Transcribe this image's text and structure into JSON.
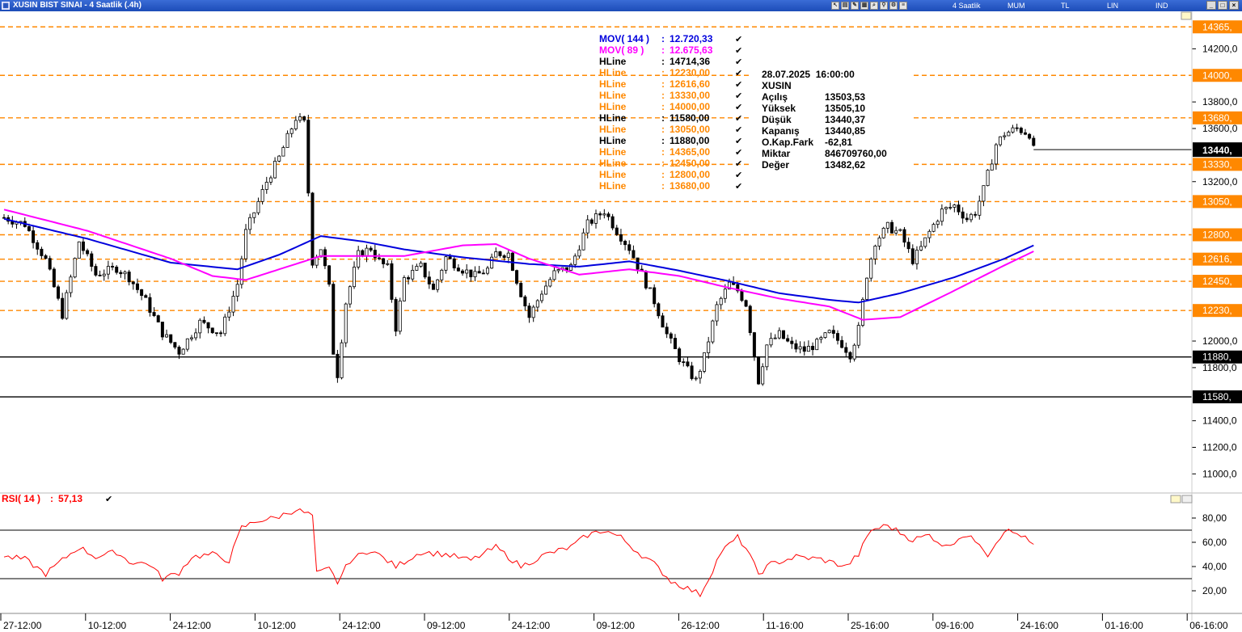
{
  "window": {
    "title": "XUSIN BIST SINAI - 4 Saatlik (.4h)",
    "period": "4 Saatlik",
    "style": "MUM",
    "currency": "TL",
    "scale": "LIN",
    "mode": "IND"
  },
  "colors": {
    "mov144": "#0000dd",
    "mov89": "#ff00ff",
    "hline_orange": "#ff8800",
    "hline_black": "#000000",
    "rsi": "#ff0000",
    "candle": "#000000"
  },
  "legend": [
    {
      "label": "MOV( 144 )",
      "sep": ":",
      "value": "12.720,33",
      "color": "#0000dd"
    },
    {
      "label": "MOV( 89 )",
      "sep": ":",
      "value": "12.675,63",
      "color": "#ff00ff"
    },
    {
      "label": "HLine",
      "sep": ":",
      "value": "14714,36",
      "color": "#000000"
    },
    {
      "label": "HLine",
      "sep": ":",
      "value": "12230,00",
      "color": "#ff8800"
    },
    {
      "label": "HLine",
      "sep": ":",
      "value": "12616,60",
      "color": "#ff8800"
    },
    {
      "label": "HLine",
      "sep": ":",
      "value": "13330,00",
      "color": "#ff8800"
    },
    {
      "label": "HLine",
      "sep": ":",
      "value": "14000,00",
      "color": "#ff8800"
    },
    {
      "label": "HLine",
      "sep": ":",
      "value": "11580,00",
      "color": "#000000"
    },
    {
      "label": "HLine",
      "sep": ":",
      "value": "13050,00",
      "color": "#ff8800"
    },
    {
      "label": "HLine",
      "sep": ":",
      "value": "11880,00",
      "color": "#000000"
    },
    {
      "label": "HLine",
      "sep": ":",
      "value": "14365,00",
      "color": "#ff8800"
    },
    {
      "label": "HLine",
      "sep": ":",
      "value": "12450,00",
      "color": "#ff8800"
    },
    {
      "label": "HLine",
      "sep": ":",
      "value": "12800,00",
      "color": "#ff8800"
    },
    {
      "label": "HLine",
      "sep": ":",
      "value": "13680,00",
      "color": "#ff8800"
    }
  ],
  "info": {
    "datetime": "28.07.2025  16:00:00",
    "symbol": "XUSIN",
    "rows": [
      {
        "label": "Açılış",
        "value": "13503,53"
      },
      {
        "label": "Yüksek",
        "value": "13505,10"
      },
      {
        "label": "Düşük",
        "value": "13440,37"
      },
      {
        "label": "Kapanış",
        "value": "13440,85"
      },
      {
        "label": "O.Kap.Fark",
        "value": "-62,81"
      },
      {
        "label": "Miktar",
        "value": "846709760,00"
      },
      {
        "label": "Değer",
        "value": "13482,62"
      }
    ]
  },
  "chart_data": {
    "type": "candlestick",
    "title": "XUSIN BIST SINAI - 4 Saatlik (.4h)",
    "price_axis": {
      "ylim": [
        10800,
        14450
      ],
      "ticks": [
        {
          "value": 11000,
          "label": "11000,0"
        },
        {
          "value": 11200,
          "label": "11200,0"
        },
        {
          "value": 11400,
          "label": "11400,0"
        },
        {
          "value": 11800,
          "label": "11800,0"
        },
        {
          "value": 12000,
          "label": "12000,0"
        },
        {
          "value": 13200,
          "label": "13200,0"
        },
        {
          "value": 13600,
          "label": "13600,0"
        },
        {
          "value": 13800,
          "label": "13800,0"
        },
        {
          "value": 14200,
          "label": "14200,0"
        }
      ]
    },
    "hlines": [
      {
        "value": 14365,
        "label": "14365,",
        "style": "dashed",
        "color": "#ff8800"
      },
      {
        "value": 14000,
        "label": "14000,",
        "style": "dashed",
        "color": "#ff8800"
      },
      {
        "value": 13680,
        "label": "13680,",
        "style": "dashed",
        "color": "#ff8800"
      },
      {
        "value": 13330,
        "label": "13330,",
        "style": "dashed",
        "color": "#ff8800"
      },
      {
        "value": 13050,
        "label": "13050,",
        "style": "dashed",
        "color": "#ff8800"
      },
      {
        "value": 12800,
        "label": "12800,",
        "style": "dashed",
        "color": "#ff8800"
      },
      {
        "value": 12616.6,
        "label": "12616,",
        "style": "dashed",
        "color": "#ff8800"
      },
      {
        "value": 12450,
        "label": "12450,",
        "style": "dashed",
        "color": "#ff8800"
      },
      {
        "value": 12230,
        "label": "12230,",
        "style": "dashed",
        "color": "#ff8800"
      },
      {
        "value": 11880,
        "label": "11880,",
        "style": "solid",
        "color": "#000000"
      },
      {
        "value": 11580,
        "label": "11580,",
        "style": "solid",
        "color": "#000000"
      }
    ],
    "last_price": {
      "value": 13440.85,
      "label": "13440,"
    },
    "time_axis": [
      "27-12:00",
      "10-12:00",
      "24-12:00",
      "10-12:00",
      "24-12:00",
      "09-12:00",
      "24-12:00",
      "09-12:00",
      "26-12:00",
      "11-16:00",
      "25-16:00",
      "09-16:00",
      "24-16:00",
      "01-16:00",
      "06-16:00"
    ],
    "close_path": [
      [
        0,
        12930
      ],
      [
        5,
        12880
      ],
      [
        10,
        12610
      ],
      [
        14,
        12200
      ],
      [
        18,
        12750
      ],
      [
        22,
        12500
      ],
      [
        27,
        12550
      ],
      [
        30,
        12480
      ],
      [
        34,
        12300
      ],
      [
        38,
        12060
      ],
      [
        42,
        11920
      ],
      [
        47,
        12140
      ],
      [
        52,
        12060
      ],
      [
        56,
        12430
      ],
      [
        58,
        12820
      ],
      [
        60,
        12970
      ],
      [
        63,
        13200
      ],
      [
        66,
        13380
      ],
      [
        70,
        13680
      ],
      [
        72,
        13640
      ],
      [
        74,
        12600
      ],
      [
        76,
        12700
      ],
      [
        78,
        12400
      ],
      [
        79,
        11920
      ],
      [
        80,
        11750
      ],
      [
        82,
        12290
      ],
      [
        85,
        12650
      ],
      [
        88,
        12700
      ],
      [
        90,
        12600
      ],
      [
        92,
        12550
      ],
      [
        94,
        12100
      ],
      [
        96,
        12470
      ],
      [
        100,
        12560
      ],
      [
        103,
        12380
      ],
      [
        106,
        12630
      ],
      [
        110,
        12540
      ],
      [
        113,
        12490
      ],
      [
        116,
        12540
      ],
      [
        118,
        12660
      ],
      [
        121,
        12660
      ],
      [
        124,
        12360
      ],
      [
        126,
        12180
      ],
      [
        129,
        12370
      ],
      [
        132,
        12510
      ],
      [
        136,
        12560
      ],
      [
        140,
        12880
      ],
      [
        142,
        12930
      ],
      [
        144,
        12980
      ],
      [
        147,
        12830
      ],
      [
        150,
        12700
      ],
      [
        153,
        12500
      ],
      [
        156,
        12300
      ],
      [
        159,
        12050
      ],
      [
        162,
        11870
      ],
      [
        164,
        11780
      ],
      [
        166,
        11700
      ],
      [
        168,
        11880
      ],
      [
        171,
        12260
      ],
      [
        174,
        12430
      ],
      [
        176,
        12380
      ],
      [
        178,
        12280
      ],
      [
        181,
        11700
      ],
      [
        183,
        11970
      ],
      [
        186,
        12050
      ],
      [
        189,
        11960
      ],
      [
        192,
        11930
      ],
      [
        195,
        11980
      ],
      [
        198,
        12060
      ],
      [
        201,
        11980
      ],
      [
        203,
        11900
      ],
      [
        205,
        12090
      ],
      [
        207,
        12500
      ],
      [
        209,
        12750
      ],
      [
        212,
        12860
      ],
      [
        215,
        12810
      ],
      [
        218,
        12610
      ],
      [
        220,
        12700
      ],
      [
        222,
        12820
      ],
      [
        225,
        12980
      ],
      [
        228,
        13020
      ],
      [
        231,
        12920
      ],
      [
        233,
        12970
      ],
      [
        235,
        13140
      ],
      [
        238,
        13480
      ],
      [
        240,
        13560
      ],
      [
        243,
        13600
      ],
      [
        246,
        13560
      ],
      [
        247,
        13440
      ]
    ],
    "series": [
      {
        "name": "MOV( 144 )",
        "color": "#0000dd",
        "values": [
          [
            0,
            12920
          ],
          [
            20,
            12770
          ],
          [
            40,
            12590
          ],
          [
            56,
            12540
          ],
          [
            66,
            12650
          ],
          [
            76,
            12790
          ],
          [
            86,
            12750
          ],
          [
            96,
            12690
          ],
          [
            110,
            12630
          ],
          [
            126,
            12580
          ],
          [
            138,
            12560
          ],
          [
            150,
            12600
          ],
          [
            162,
            12530
          ],
          [
            174,
            12450
          ],
          [
            186,
            12360
          ],
          [
            198,
            12310
          ],
          [
            205,
            12290
          ],
          [
            215,
            12360
          ],
          [
            228,
            12480
          ],
          [
            240,
            12620
          ],
          [
            247,
            12720
          ]
        ]
      },
      {
        "name": "MOV( 89 )",
        "color": "#ff00ff",
        "values": [
          [
            0,
            12990
          ],
          [
            20,
            12830
          ],
          [
            40,
            12620
          ],
          [
            50,
            12490
          ],
          [
            58,
            12460
          ],
          [
            66,
            12540
          ],
          [
            76,
            12640
          ],
          [
            86,
            12640
          ],
          [
            96,
            12640
          ],
          [
            110,
            12720
          ],
          [
            118,
            12730
          ],
          [
            126,
            12620
          ],
          [
            138,
            12500
          ],
          [
            150,
            12540
          ],
          [
            162,
            12490
          ],
          [
            174,
            12400
          ],
          [
            186,
            12320
          ],
          [
            198,
            12260
          ],
          [
            206,
            12160
          ],
          [
            215,
            12180
          ],
          [
            228,
            12380
          ],
          [
            240,
            12570
          ],
          [
            247,
            12675
          ]
        ]
      }
    ],
    "rsi": {
      "name": "RSI( 14 )",
      "value_label": "57,13",
      "ylim": [
        10,
        90
      ],
      "levels": [
        70,
        30
      ],
      "ticks": [
        {
          "value": 20,
          "label": "20,00"
        },
        {
          "value": 40,
          "label": "40,00"
        },
        {
          "value": 60,
          "label": "60,00"
        },
        {
          "value": 80,
          "label": "80,00"
        }
      ],
      "path": [
        [
          0,
          48
        ],
        [
          5,
          46
        ],
        [
          10,
          34
        ],
        [
          15,
          48
        ],
        [
          18,
          56
        ],
        [
          22,
          48
        ],
        [
          27,
          52
        ],
        [
          30,
          44
        ],
        [
          35,
          42
        ],
        [
          38,
          30
        ],
        [
          42,
          35
        ],
        [
          45,
          48
        ],
        [
          50,
          50
        ],
        [
          54,
          45
        ],
        [
          57,
          72
        ],
        [
          61,
          78
        ],
        [
          65,
          80
        ],
        [
          70,
          87
        ],
        [
          74,
          82
        ],
        [
          75,
          34
        ],
        [
          78,
          38
        ],
        [
          80,
          27
        ],
        [
          83,
          45
        ],
        [
          88,
          54
        ],
        [
          94,
          40
        ],
        [
          100,
          52
        ],
        [
          106,
          50
        ],
        [
          112,
          45
        ],
        [
          118,
          56
        ],
        [
          124,
          40
        ],
        [
          130,
          50
        ],
        [
          136,
          56
        ],
        [
          140,
          66
        ],
        [
          144,
          70
        ],
        [
          148,
          64
        ],
        [
          152,
          52
        ],
        [
          156,
          42
        ],
        [
          160,
          28
        ],
        [
          164,
          22
        ],
        [
          167,
          17
        ],
        [
          169,
          30
        ],
        [
          172,
          52
        ],
        [
          176,
          64
        ],
        [
          178,
          55
        ],
        [
          181,
          34
        ],
        [
          184,
          42
        ],
        [
          190,
          48
        ],
        [
          196,
          46
        ],
        [
          202,
          40
        ],
        [
          205,
          50
        ],
        [
          208,
          70
        ],
        [
          212,
          74
        ],
        [
          218,
          62
        ],
        [
          222,
          66
        ],
        [
          226,
          56
        ],
        [
          230,
          66
        ],
        [
          234,
          60
        ],
        [
          236,
          50
        ],
        [
          240,
          70
        ],
        [
          244,
          66
        ],
        [
          247,
          57
        ]
      ]
    }
  }
}
